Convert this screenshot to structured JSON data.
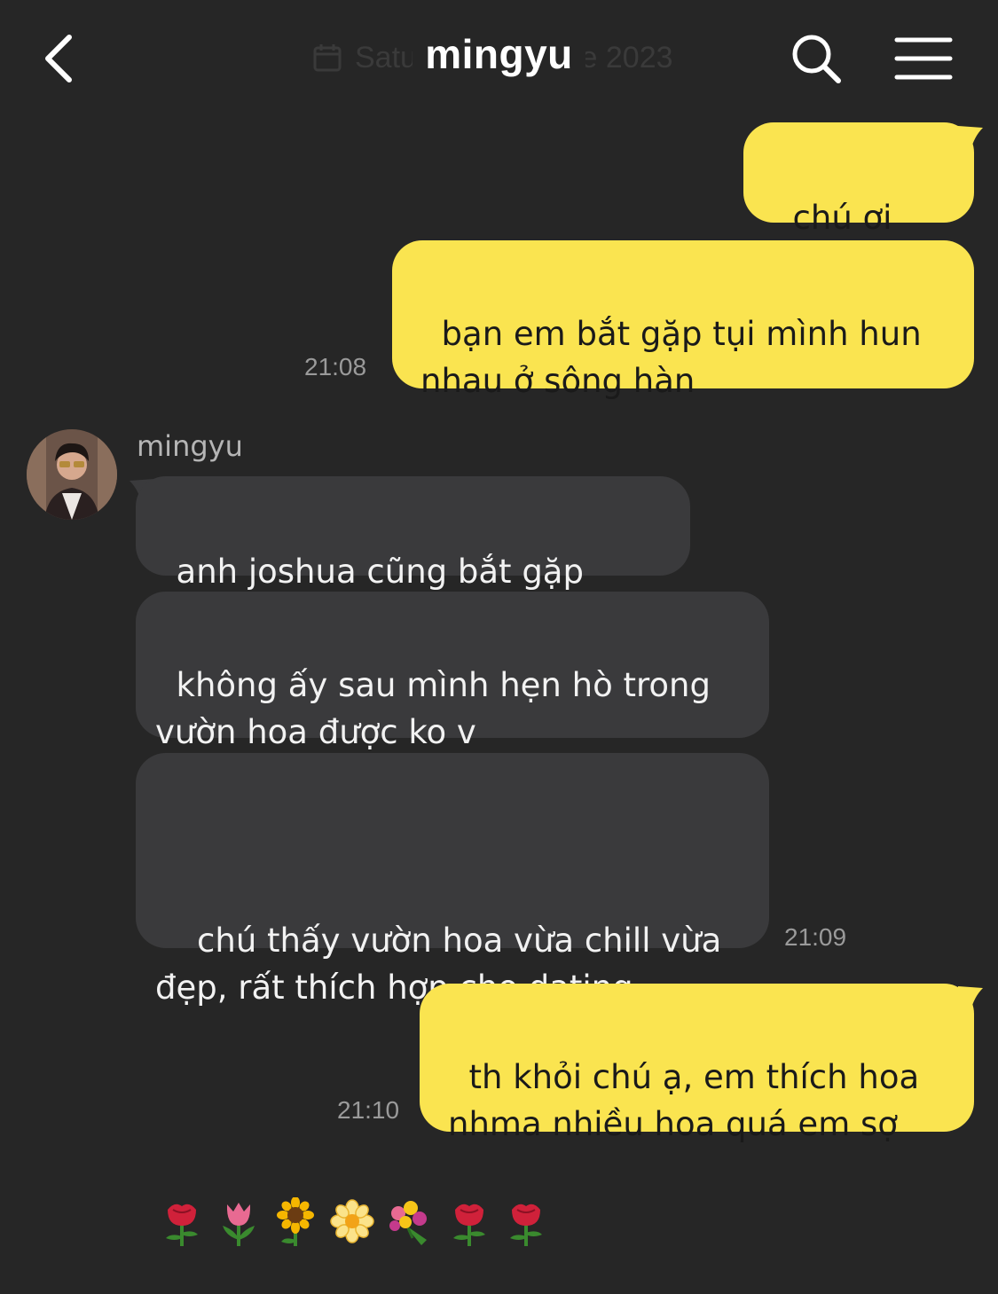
{
  "header": {
    "title": "mingyu",
    "date_overlay": "Saturday, 17 June 2023"
  },
  "colors": {
    "background": "#262626",
    "sent_bubble": "#fae450",
    "received_bubble": "#3a3a3c",
    "timestamp": "#9a9a9a"
  },
  "messages": [
    {
      "from": "me",
      "text": "chú ơi"
    },
    {
      "from": "me",
      "text": "bạn em bắt gặp tụi mình hun\nnhau ở sông hàn",
      "time": "21:08"
    },
    {
      "from": "mingyu",
      "sender": "mingyu",
      "text": "anh joshua cũng bắt gặp"
    },
    {
      "from": "mingyu",
      "text": "không ấy sau mình hẹn hò trong\nvườn hoa được ko v"
    },
    {
      "from": "mingyu",
      "text": "chú thấy vườn hoa vừa chill vừa\nđẹp, rất thích hợp cho dating",
      "time": "21:09"
    },
    {
      "from": "me",
      "text": "th khỏi chú ạ, em thích hoa\nnhma nhiều hoa quá em sợ",
      "time": "21:10"
    }
  ],
  "icons": {
    "back": "chevron-left-icon",
    "search": "search-icon",
    "menu": "hamburger-menu-icon",
    "calendar": "calendar-icon"
  }
}
